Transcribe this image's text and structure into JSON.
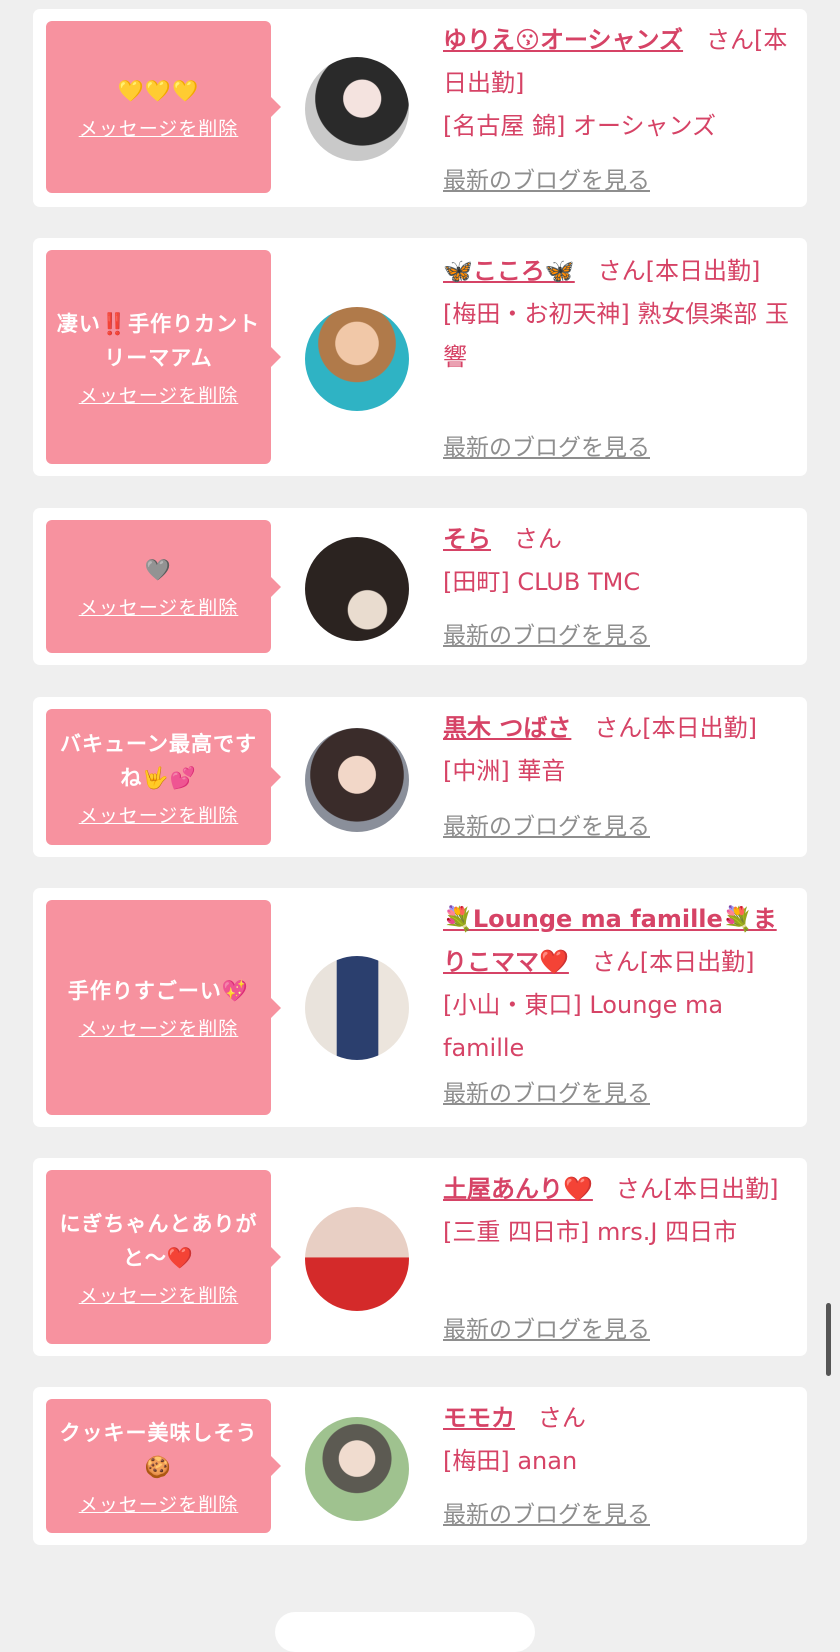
{
  "delete_label": "メッセージを削除",
  "blog_label": "最新のブログを見る",
  "san_label": "さん",
  "cards": [
    {
      "message": "💛💛💛",
      "name": "ゆりえ😗オーシャンズ",
      "tail": "さん[本日出勤]",
      "shop": "[名古屋 錦] オーシャンズ"
    },
    {
      "message": "凄い‼️手作りカントリーマアム",
      "name": "🦋こころ🦋",
      "tail": "さん[本日出勤]",
      "shop": "[梅田・お初天神] 熟女倶楽部 玉響"
    },
    {
      "message": "🩶",
      "name": "そら",
      "tail": "さん",
      "shop": "[田町] CLUB TMC"
    },
    {
      "message": "バキューン最高ですね🤟💕",
      "name": "黒木 つばさ",
      "tail": "さん[本日出勤]",
      "shop": "[中洲] 華音"
    },
    {
      "message": "手作りすごーい💖",
      "name": "💐Lounge ma famille💐まりこママ❤️",
      "tail": "さん[本日出勤]",
      "shop": "[小山・東口] Lounge ma famille"
    },
    {
      "message": "にぎちゃんとありがと〜❤️",
      "name": "土屋あんり❤️",
      "tail": "さん[本日出勤]",
      "shop": "[三重 四日市] mrs.J 四日市"
    },
    {
      "message": "クッキー美味しそう🍪",
      "name": "モモカ",
      "tail": "さん",
      "shop": "[梅田] anan"
    }
  ]
}
